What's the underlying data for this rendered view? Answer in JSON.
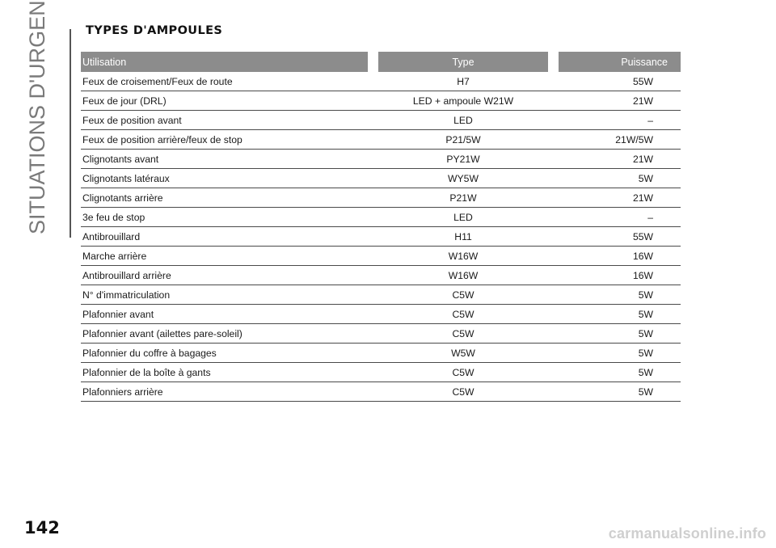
{
  "sidebar": {
    "section_label": "SITUATIONS D'URGENCE"
  },
  "section": {
    "title": "TYPES D'AMPOULES"
  },
  "table": {
    "headers": {
      "usage": "Utilisation",
      "type": "Type",
      "power": "Puissance"
    },
    "rows": [
      {
        "usage": "Feux de croisement/Feux de route",
        "type": "H7",
        "power": "55W"
      },
      {
        "usage": "Feux de jour (DRL)",
        "type": "LED + ampoule W21W",
        "power": "21W"
      },
      {
        "usage": "Feux de position avant",
        "type": "LED",
        "power": "–"
      },
      {
        "usage": "Feux de position arrière/feux de stop",
        "type": "P21/5W",
        "power": "21W/5W"
      },
      {
        "usage": "Clignotants avant",
        "type": "PY21W",
        "power": "21W"
      },
      {
        "usage": "Clignotants latéraux",
        "type": "WY5W",
        "power": "5W"
      },
      {
        "usage": "Clignotants arrière",
        "type": "P21W",
        "power": "21W"
      },
      {
        "usage": "3e feu de stop",
        "type": "LED",
        "power": "–"
      },
      {
        "usage": "Antibrouillard",
        "type": "H11",
        "power": "55W"
      },
      {
        "usage": "Marche arrière",
        "type": "W16W",
        "power": "16W"
      },
      {
        "usage": "Antibrouillard arrière",
        "type": "W16W",
        "power": "16W"
      },
      {
        "usage": "N° d'immatriculation",
        "type": "C5W",
        "power": "5W"
      },
      {
        "usage": "Plafonnier avant",
        "type": "C5W",
        "power": "5W"
      },
      {
        "usage": "Plafonnier avant (ailettes pare-soleil)",
        "type": "C5W",
        "power": "5W"
      },
      {
        "usage": "Plafonnier du coffre à bagages",
        "type": "W5W",
        "power": "5W"
      },
      {
        "usage": "Plafonnier de la boîte à gants",
        "type": "C5W",
        "power": "5W"
      },
      {
        "usage": "Plafonniers arrière",
        "type": "C5W",
        "power": "5W"
      }
    ]
  },
  "footer": {
    "page_number": "142",
    "watermark": "carmanualsonline.info"
  },
  "colors": {
    "header_bg": "#8c8c8c",
    "header_text": "#ffffff",
    "rule": "#4a4a4a",
    "side_title": "#7a7a7a",
    "watermark": "#cfcfcf"
  }
}
